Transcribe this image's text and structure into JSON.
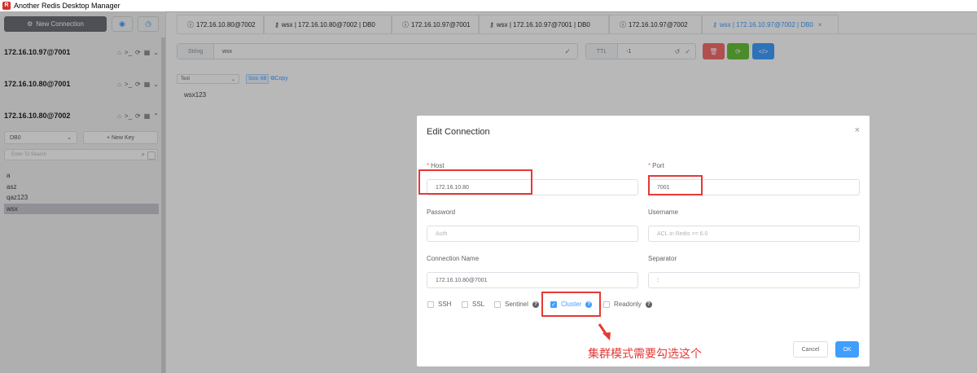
{
  "app": {
    "title": "Another Redis Desktop Manager"
  },
  "sidebar": {
    "new_connection": "New Connection",
    "connections": [
      {
        "name": "172.16.10.97@7001"
      },
      {
        "name": "172.16.10.80@7001"
      },
      {
        "name": "172.16.10.80@7002"
      }
    ],
    "db_select": "DB0",
    "new_key": "+ New Key",
    "search_placeholder": "Enter To Search",
    "keys": [
      "a",
      "asz",
      "qaz123",
      "wsx"
    ],
    "selected_key": "wsx"
  },
  "tabs": [
    {
      "label": "172.16.10.80@7002",
      "icon": "info-icon"
    },
    {
      "label": "wsx | 172.16.10.80@7002 | DB0",
      "icon": "key-icon"
    },
    {
      "label": "172.16.10.97@7001",
      "icon": "info-icon"
    },
    {
      "label": "wsx | 172.16.10.97@7001 | DB0",
      "icon": "key-icon"
    },
    {
      "label": "172.16.10.97@7002",
      "icon": "info-icon"
    },
    {
      "label": "wsx | 172.16.10.97@7002 | DB0",
      "icon": "key-icon",
      "active": true
    }
  ],
  "key_view": {
    "type_label": "String",
    "key_name": "wsx",
    "ttl_label": "TTL",
    "ttl_value": "-1",
    "view_as": "Text",
    "size": "Size: 6B",
    "copy": "Copy",
    "value": "wsx123"
  },
  "dialog": {
    "title": "Edit Connection",
    "host_label": "Host",
    "host_value": "172.16.10.80",
    "port_label": "Port",
    "port_value": "7001",
    "password_label": "Password",
    "password_placeholder": "Auth",
    "username_label": "Username",
    "username_placeholder": "ACL in Redis >= 6.0",
    "name_label": "Connection Name",
    "name_value": "172.16.10.80@7001",
    "separator_label": "Separator",
    "separator_value": ":",
    "options": [
      {
        "label": "SSH",
        "checked": false
      },
      {
        "label": "SSL",
        "checked": false
      },
      {
        "label": "Sentinel",
        "checked": false
      },
      {
        "label": "Cluster",
        "checked": true
      },
      {
        "label": "Readonly",
        "checked": false
      }
    ],
    "cancel": "Cancel",
    "ok": "OK"
  },
  "annotation": "集群模式需要勾选这个",
  "colors": {
    "accent": "#409eff",
    "danger": "#f56c6c",
    "success": "#67c23a",
    "annotation": "#e53935",
    "sidebar_button": "#6e7076"
  }
}
